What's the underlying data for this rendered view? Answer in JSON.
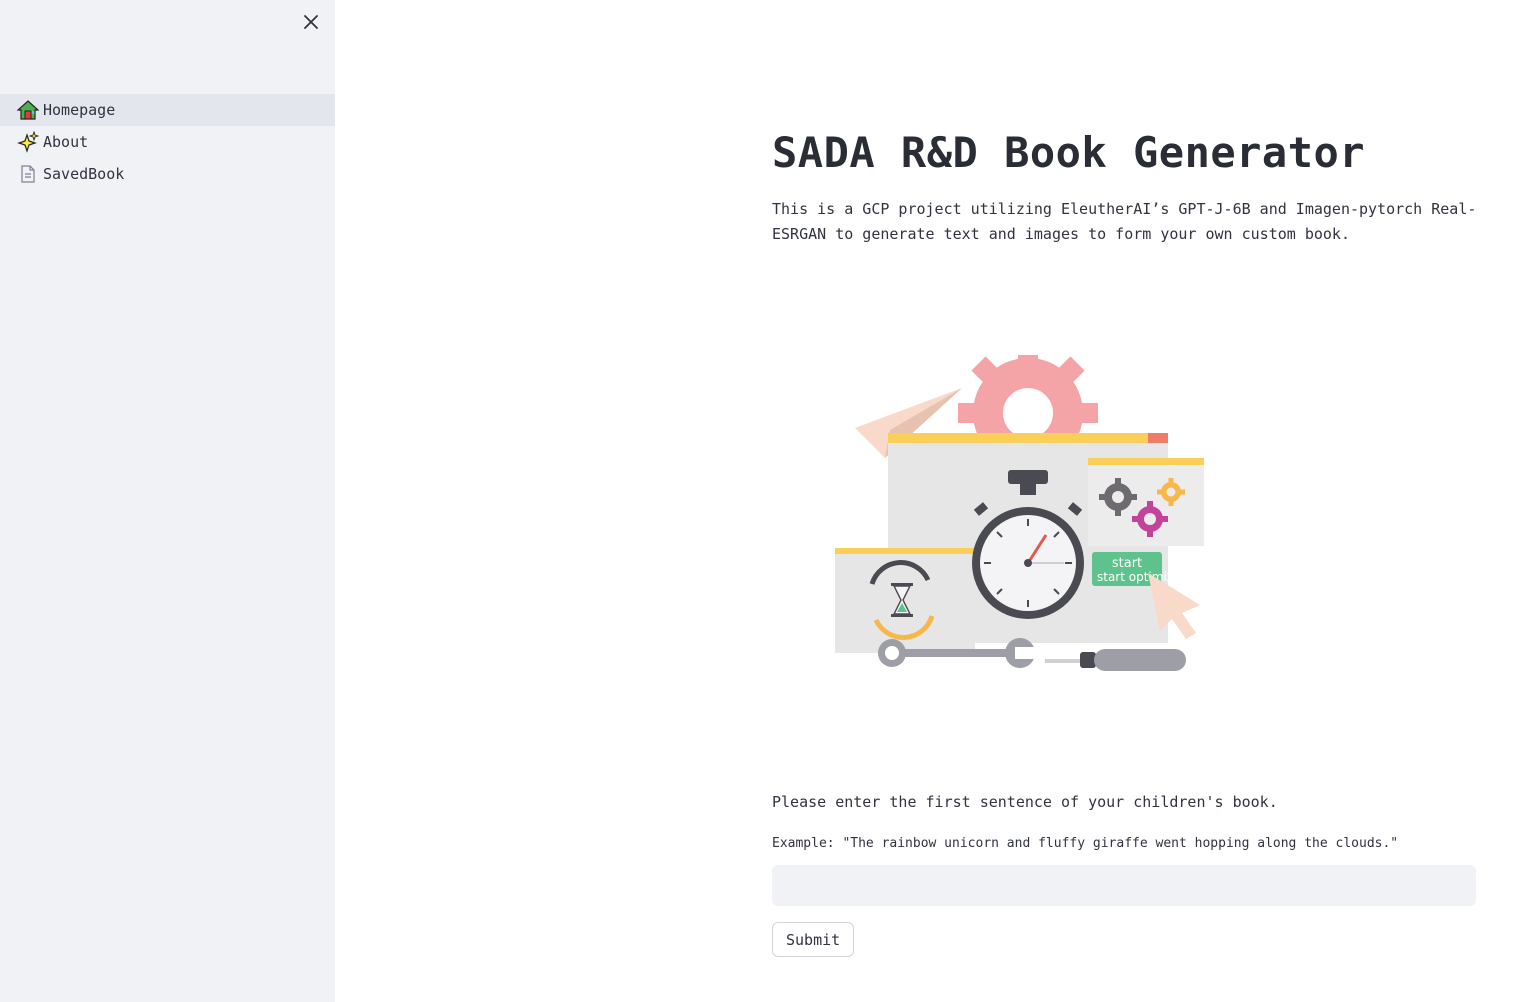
{
  "sidebar": {
    "close_icon": "close-icon",
    "items": [
      {
        "label": "Homepage",
        "icon": "house-icon",
        "active": true
      },
      {
        "label": "About",
        "icon": "sparkles-icon",
        "active": false
      },
      {
        "label": "SavedBook",
        "icon": "document-icon",
        "active": false
      }
    ]
  },
  "main": {
    "title": "SADA R&D Book Generator",
    "description": "This is a GCP project utilizing EleutherAI’s GPT-J-6B and Imagen-pytorch Real-ESRGAN to generate text and images to form your own custom book.",
    "illustration": {
      "button_text": "start optimiz"
    },
    "prompt": "Please enter the first sentence of your children's book.",
    "example": "Example: \"The rainbow unicorn and fluffy giraffe went hopping along the clouds.\"",
    "input_value": "",
    "submit_label": "Submit"
  },
  "colors": {
    "sidebar_bg": "#f0f2f6",
    "active_item_bg": "#e3e6ec",
    "text": "#31333f"
  }
}
